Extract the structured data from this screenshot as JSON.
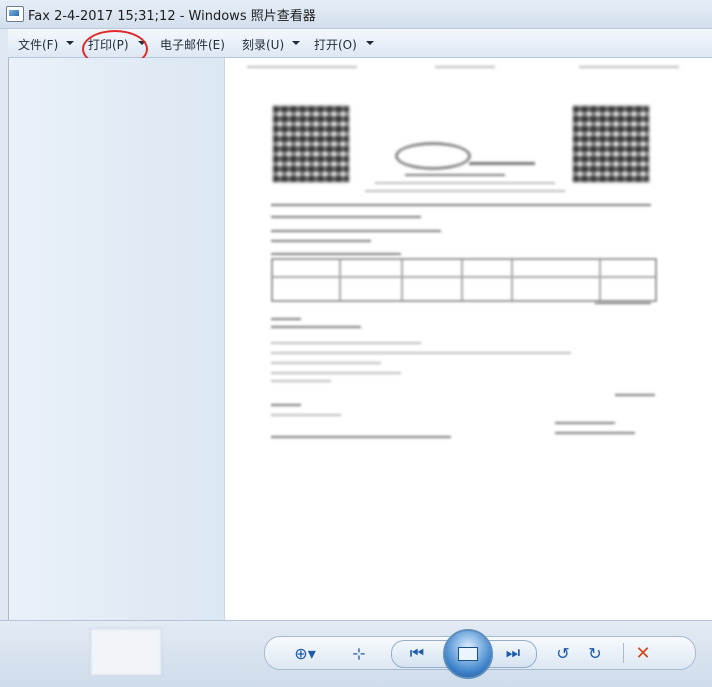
{
  "window": {
    "title": "Fax 2-4-2017 15;31;12 - Windows 照片查看器",
    "icon": "photo-viewer-icon"
  },
  "menu": {
    "items": [
      {
        "label": "文件(F)",
        "has_dropdown": true
      },
      {
        "label": "打印(P)",
        "has_dropdown": true
      },
      {
        "label": "电子邮件(E)",
        "has_dropdown": false
      },
      {
        "label": "刻录(U)",
        "has_dropdown": true
      },
      {
        "label": "打开(O)",
        "has_dropdown": true
      }
    ],
    "highlight_color": "#e02a2a"
  },
  "toolbar": {
    "buttons": [
      {
        "name": "zoom-icon",
        "glyph": "⊕▾"
      },
      {
        "name": "actual-size-icon",
        "glyph": "⊹"
      },
      {
        "name": "previous-icon",
        "glyph": "⏮"
      },
      {
        "name": "slideshow-icon",
        "glyph": ""
      },
      {
        "name": "next-icon",
        "glyph": "⏭"
      },
      {
        "name": "rotate-left-icon",
        "glyph": "↺"
      },
      {
        "name": "rotate-right-icon",
        "glyph": "↻"
      },
      {
        "name": "delete-icon",
        "glyph": "✕"
      }
    ]
  },
  "colors": {
    "accent": "#1d5aa8",
    "delete": "#d3461d"
  }
}
